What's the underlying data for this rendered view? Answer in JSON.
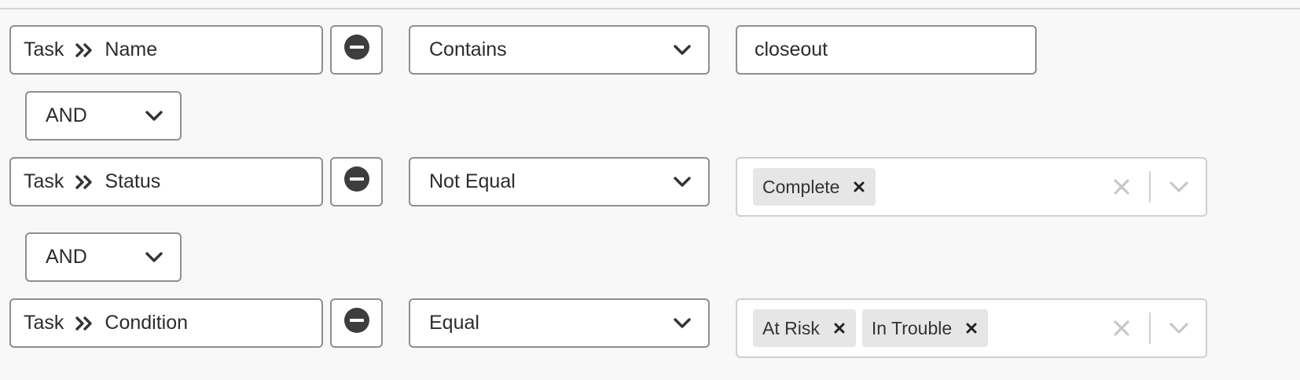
{
  "rows": [
    {
      "field": {
        "entity": "Task",
        "attribute": "Name"
      },
      "operator": "Contains",
      "value_text": "closeout"
    },
    {
      "field": {
        "entity": "Task",
        "attribute": "Status"
      },
      "operator": "Not Equal",
      "value_tags": [
        "Complete"
      ]
    },
    {
      "field": {
        "entity": "Task",
        "attribute": "Condition"
      },
      "operator": "Equal",
      "value_tags": [
        "At Risk",
        "In Trouble"
      ]
    }
  ],
  "logic": [
    "AND",
    "AND"
  ],
  "icons": {
    "remove": "minus-circle-icon",
    "path_separator": "double-chevron-right-icon",
    "dropdown": "chevron-down-icon",
    "tag_remove": "close-icon",
    "clear_all": "close-icon"
  },
  "colors": {
    "background": "#f8f8f8",
    "border": "#8f8f8f",
    "tag_background": "#e6e6e6",
    "muted_icon": "#c8c8c8"
  }
}
